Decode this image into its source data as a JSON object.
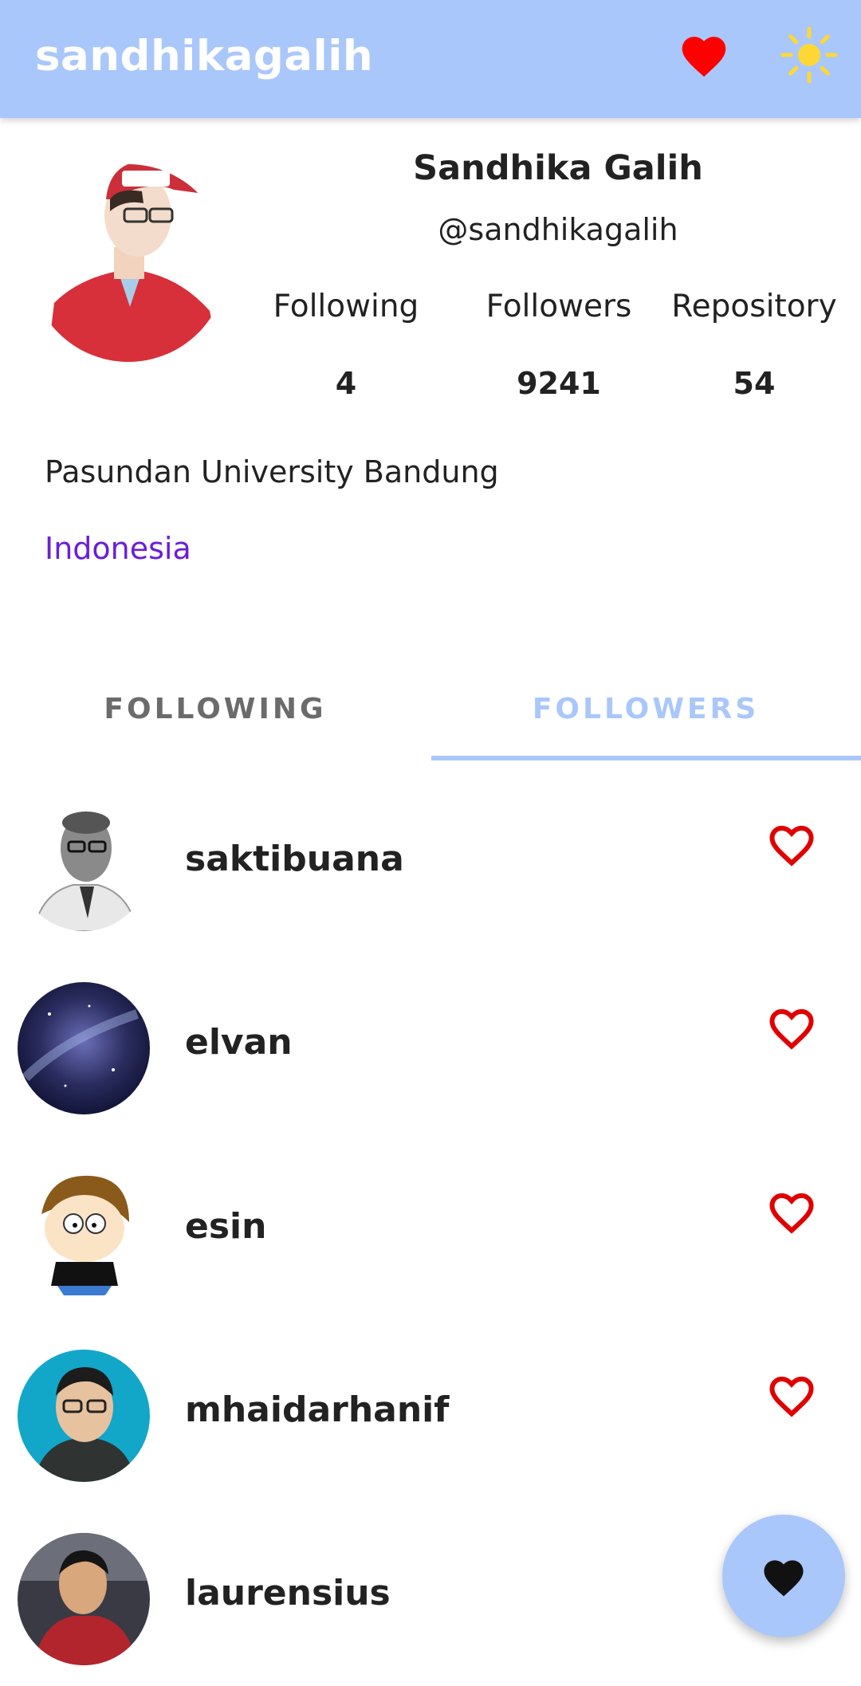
{
  "app_bar": {
    "title": "sandhikagalih",
    "favorite_icon": "heart-filled-icon",
    "favorite_color": "#ff0000",
    "theme_icon": "sun-icon",
    "theme_color": "#fdd835",
    "background": "#a9c7fb"
  },
  "profile": {
    "name": "Sandhika Galih",
    "username": "@sandhikagalih",
    "stats": {
      "following_label": "Following",
      "following_value": "4",
      "followers_label": "Followers",
      "followers_value": "9241",
      "repository_label": "Repository",
      "repository_value": "54"
    },
    "company": "Pasundan University Bandung",
    "location": "Indonesia"
  },
  "tabs": {
    "following_label": "FOLLOWING",
    "followers_label": "FOLLOWERS",
    "selected": "FOLLOWERS"
  },
  "followers": [
    {
      "username": "saktibuana"
    },
    {
      "username": "elvan"
    },
    {
      "username": "esin"
    },
    {
      "username": "mhaidarhanif"
    },
    {
      "username": "laurensius"
    }
  ],
  "fab": {
    "icon": "heart-filled-icon",
    "background": "#a9c7fb"
  }
}
